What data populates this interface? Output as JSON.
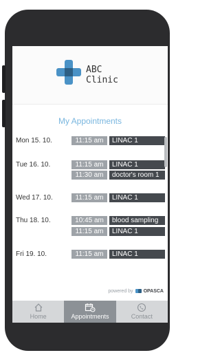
{
  "brand": {
    "name": "ABC\nClinic"
  },
  "page_title": "My Appointments",
  "appointments": [
    {
      "day": "Mon 15. 10.",
      "time": "11:15 am",
      "place": "LINAC 1"
    },
    {
      "day": "Tue 16. 10.",
      "time": "11:15 am",
      "place": "LINAC 1"
    },
    {
      "day": "",
      "time": "11:30 am",
      "place": "doctor's room 1"
    },
    {
      "day": "Wed 17. 10.",
      "time": "11:15 am",
      "place": "LINAC 1"
    },
    {
      "day": "Thu 18. 10.",
      "time": "10:45 am",
      "place": "blood sampling"
    },
    {
      "day": "",
      "time": "11:15 am",
      "place": "LINAC 1"
    },
    {
      "day": "Fri 19. 10.",
      "time": "11:15 am",
      "place": "LINAC 1"
    }
  ],
  "footer": {
    "powered_by": "powered by",
    "vendor": "OPASCA"
  },
  "tabs": [
    {
      "label": "Home",
      "icon": "home-icon",
      "active": false
    },
    {
      "label": "Appointments",
      "icon": "calendar-icon",
      "active": true
    },
    {
      "label": "Contact",
      "icon": "phone-icon",
      "active": false
    }
  ],
  "colors": {
    "accent": "#4a92c6",
    "time_cell": "#9ea3a8",
    "place_cell": "#45494e",
    "title": "#79b6df"
  }
}
